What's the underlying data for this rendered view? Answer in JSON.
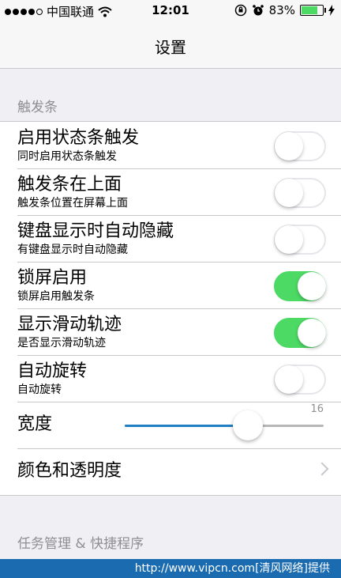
{
  "status_bar": {
    "carrier": "中国联通",
    "time": "12:01",
    "battery": "83%",
    "battery_level": 0.83,
    "signal_bars": 4
  },
  "nav": {
    "title": "设置"
  },
  "sections": [
    {
      "header": "触发条"
    },
    {
      "header": "任务管理 & 快捷程序"
    }
  ],
  "toggles": [
    {
      "title": "启用状态条触发",
      "subtitle": "同时启用状态条触发",
      "on": false
    },
    {
      "title": "触发条在上面",
      "subtitle": "触发条位置在屏幕上面",
      "on": false
    },
    {
      "title": "键盘显示时自动隐藏",
      "subtitle": "有键盘显示时自动隐藏",
      "on": false
    },
    {
      "title": "锁屏启用",
      "subtitle": "锁屏启用触发条",
      "on": true
    },
    {
      "title": "显示滑动轨迹",
      "subtitle": "是否显示滑动轨迹",
      "on": true
    },
    {
      "title": "自动旋转",
      "subtitle": "自动旋转",
      "on": false
    }
  ],
  "width_setting": {
    "label": "宽度",
    "value": "16",
    "fraction": 0.62
  },
  "color_setting": {
    "label": "颜色和透明度"
  },
  "watermark": "http://www.vipcn.com[清风网络]提供",
  "colors": {
    "accent": "#1f7ec6",
    "switch_on": "#4cd964",
    "background": "#efeff4"
  }
}
